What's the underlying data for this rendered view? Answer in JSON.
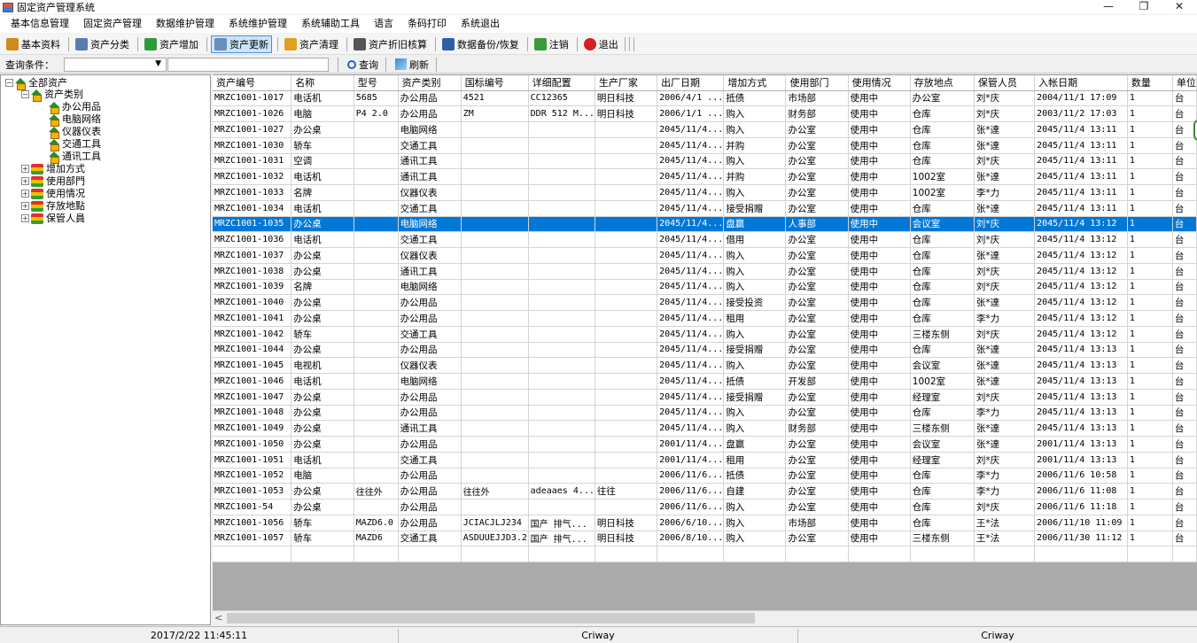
{
  "window": {
    "title": "固定资产管理系统",
    "controls": [
      "—",
      "❐",
      "✕"
    ]
  },
  "menu": [
    "基本信息管理",
    "固定资产管理",
    "数据维护管理",
    "系统维护管理",
    "系统辅助工具",
    "语言",
    "条码打印",
    "系统退出"
  ],
  "toolbar": [
    {
      "label": "基本资料",
      "icon": "basic-data-icon",
      "color": "#d08a1a",
      "active": false
    },
    {
      "label": "资产分类",
      "icon": "asset-category-icon",
      "color": "#5a7bb0",
      "active": false
    },
    {
      "label": "资产增加",
      "icon": "asset-add-icon",
      "color": "#2e9b3b",
      "active": false
    },
    {
      "label": "资产更新",
      "icon": "asset-update-icon",
      "color": "#6a8fb8",
      "active": true
    },
    {
      "label": "资产清理",
      "icon": "asset-clear-icon",
      "color": "#e0a020",
      "active": false
    },
    {
      "label": "资产折旧核算",
      "icon": "depreciation-icon",
      "color": "#555555",
      "active": false
    },
    {
      "label": "数据备份/恢复",
      "icon": "backup-icon",
      "color": "#2d5fa8",
      "active": false
    },
    {
      "label": "注销",
      "icon": "logout-icon",
      "color": "#3a9a3a",
      "active": false
    },
    {
      "label": "退出",
      "icon": "exit-icon",
      "color": "#d42020",
      "active": false
    }
  ],
  "query": {
    "label": "查询条件：",
    "select_value": "",
    "select_arrow": "▼",
    "input_value": "",
    "search_label": "查询",
    "refresh_label": "刷新"
  },
  "tree": {
    "root": "全部资产",
    "category": "资产类别",
    "categories": [
      "办公用品",
      "电脑网络",
      "仪器仪表",
      "交通工具",
      "通讯工具"
    ],
    "groups": [
      "增加方式",
      "使用部門",
      "使用情况",
      "存放地點",
      "保管人員"
    ]
  },
  "table": {
    "columns": [
      "资产编号",
      "名称",
      "型号",
      "资产类别",
      "国标编号",
      "详细配置",
      "生产厂家",
      "出厂日期",
      "增加方式",
      "使用部门",
      "使用情况",
      "存放地点",
      "保管人员",
      "入帐日期",
      "数量",
      "单位"
    ],
    "selected_index": 8,
    "rows": [
      [
        "MRZC1001-1017",
        "电话机",
        "5685",
        "办公用品",
        "4521",
        "CC12365",
        "明日科技",
        "2006/4/1 ...",
        "抵债",
        "市场部",
        "使用中",
        "办公室",
        "刘*庆",
        "2004/11/1 17:09",
        "1",
        "台"
      ],
      [
        "MRZC1001-1026",
        "电脑",
        "P4 2.0",
        "办公用品",
        "ZM",
        "DDR 512 M...",
        "明日科技",
        "2006/1/1 ...",
        "购入",
        "财务部",
        "使用中",
        "仓库",
        "刘*庆",
        "2003/11/2 17:03",
        "1",
        "台"
      ],
      [
        "MRZC1001-1027",
        "办公桌",
        "",
        "电脑网络",
        "",
        "",
        "",
        "2045/11/4...",
        "购入",
        "办公室",
        "使用中",
        "仓库",
        "张*達",
        "2045/11/4 13:11",
        "1",
        "台"
      ],
      [
        "MRZC1001-1030",
        "轿车",
        "",
        "交通工具",
        "",
        "",
        "",
        "2045/11/4...",
        "并购",
        "办公室",
        "使用中",
        "仓库",
        "张*達",
        "2045/11/4 13:11",
        "1",
        "台"
      ],
      [
        "MRZC1001-1031",
        "空调",
        "",
        "通讯工具",
        "",
        "",
        "",
        "2045/11/4...",
        "购入",
        "办公室",
        "使用中",
        "仓库",
        "刘*庆",
        "2045/11/4 13:11",
        "1",
        "台"
      ],
      [
        "MRZC1001-1032",
        "电话机",
        "",
        "通讯工具",
        "",
        "",
        "",
        "2045/11/4...",
        "并购",
        "办公室",
        "使用中",
        "1002室",
        "张*達",
        "2045/11/4 13:11",
        "1",
        "台"
      ],
      [
        "MRZC1001-1033",
        "名牌",
        "",
        "仪器仪表",
        "",
        "",
        "",
        "2045/11/4...",
        "购入",
        "办公室",
        "使用中",
        "1002室",
        "李*力",
        "2045/11/4 13:11",
        "1",
        "台"
      ],
      [
        "MRZC1001-1034",
        "电话机",
        "",
        "交通工具",
        "",
        "",
        "",
        "2045/11/4...",
        "接受捐赠",
        "办公室",
        "使用中",
        "仓库",
        "张*達",
        "2045/11/4 13:11",
        "1",
        "台"
      ],
      [
        "MRZC1001-1035",
        "办公桌",
        "",
        "电脑网络",
        "",
        "",
        "",
        "2045/11/4...",
        "盘赢",
        "人事部",
        "使用中",
        "会议室",
        "刘*庆",
        "2045/11/4 13:12",
        "1",
        "台"
      ],
      [
        "MRZC1001-1036",
        "电话机",
        "",
        "交通工具",
        "",
        "",
        "",
        "2045/11/4...",
        "借用",
        "办公室",
        "使用中",
        "仓库",
        "刘*庆",
        "2045/11/4 13:12",
        "1",
        "台"
      ],
      [
        "MRZC1001-1037",
        "办公桌",
        "",
        "仪器仪表",
        "",
        "",
        "",
        "2045/11/4...",
        "购入",
        "办公室",
        "使用中",
        "仓库",
        "张*達",
        "2045/11/4 13:12",
        "1",
        "台"
      ],
      [
        "MRZC1001-1038",
        "办公桌",
        "",
        "通讯工具",
        "",
        "",
        "",
        "2045/11/4...",
        "购入",
        "办公室",
        "使用中",
        "仓库",
        "刘*庆",
        "2045/11/4 13:12",
        "1",
        "台"
      ],
      [
        "MRZC1001-1039",
        "名牌",
        "",
        "电脑网络",
        "",
        "",
        "",
        "2045/11/4...",
        "购入",
        "办公室",
        "使用中",
        "仓库",
        "刘*庆",
        "2045/11/4 13:12",
        "1",
        "台"
      ],
      [
        "MRZC1001-1040",
        "办公桌",
        "",
        "办公用品",
        "",
        "",
        "",
        "2045/11/4...",
        "接受投资",
        "办公室",
        "使用中",
        "仓库",
        "张*達",
        "2045/11/4 13:12",
        "1",
        "台"
      ],
      [
        "MRZC1001-1041",
        "办公桌",
        "",
        "办公用品",
        "",
        "",
        "",
        "2045/11/4...",
        "租用",
        "办公室",
        "使用中",
        "仓库",
        "李*力",
        "2045/11/4 13:12",
        "1",
        "台"
      ],
      [
        "MRZC1001-1042",
        "轿车",
        "",
        "交通工具",
        "",
        "",
        "",
        "2045/11/4...",
        "购入",
        "办公室",
        "使用中",
        "三楼东侧",
        "刘*庆",
        "2045/11/4 13:12",
        "1",
        "台"
      ],
      [
        "MRZC1001-1044",
        "办公桌",
        "",
        "办公用品",
        "",
        "",
        "",
        "2045/11/4...",
        "接受捐赠",
        "办公室",
        "使用中",
        "仓库",
        "张*達",
        "2045/11/4 13:13",
        "1",
        "台"
      ],
      [
        "MRZC1001-1045",
        "电视机",
        "",
        "仪器仪表",
        "",
        "",
        "",
        "2045/11/4...",
        "购入",
        "办公室",
        "使用中",
        "会议室",
        "张*達",
        "2045/11/4 13:13",
        "1",
        "台"
      ],
      [
        "MRZC1001-1046",
        "电话机",
        "",
        "电脑网络",
        "",
        "",
        "",
        "2045/11/4...",
        "抵债",
        "开发部",
        "使用中",
        "1002室",
        "张*達",
        "2045/11/4 13:13",
        "1",
        "台"
      ],
      [
        "MRZC1001-1047",
        "办公桌",
        "",
        "办公用品",
        "",
        "",
        "",
        "2045/11/4...",
        "接受捐赠",
        "办公室",
        "使用中",
        "经理室",
        "刘*庆",
        "2045/11/4 13:13",
        "1",
        "台"
      ],
      [
        "MRZC1001-1048",
        "办公桌",
        "",
        "办公用品",
        "",
        "",
        "",
        "2045/11/4...",
        "购入",
        "办公室",
        "使用中",
        "仓库",
        "李*力",
        "2045/11/4 13:13",
        "1",
        "台"
      ],
      [
        "MRZC1001-1049",
        "办公桌",
        "",
        "通讯工具",
        "",
        "",
        "",
        "2045/11/4...",
        "购入",
        "财务部",
        "使用中",
        "三楼东侧",
        "张*達",
        "2045/11/4 13:13",
        "1",
        "台"
      ],
      [
        "MRZC1001-1050",
        "办公桌",
        "",
        "办公用品",
        "",
        "",
        "",
        "2001/11/4...",
        "盘赢",
        "办公室",
        "使用中",
        "会议室",
        "张*達",
        "2001/11/4 13:13",
        "1",
        "台"
      ],
      [
        "MRZC1001-1051",
        "电话机",
        "",
        "交通工具",
        "",
        "",
        "",
        "2001/11/4...",
        "租用",
        "办公室",
        "使用中",
        "经理室",
        "刘*庆",
        "2001/11/4 13:13",
        "1",
        "台"
      ],
      [
        "MRZC1001-1052",
        "电脑",
        "",
        "办公用品",
        "",
        "",
        "",
        "2006/11/6...",
        "抵债",
        "办公室",
        "使用中",
        "仓库",
        "李*力",
        "2006/11/6 10:58",
        "1",
        "台"
      ],
      [
        "MRZC1001-1053",
        "办公桌",
        "往往外",
        "办公用品",
        "往往外",
        "adeaaes 4...",
        "往往",
        "2006/11/6...",
        "自建",
        "办公室",
        "使用中",
        "仓库",
        "李*力",
        "2006/11/6 11:08",
        "1",
        "台"
      ],
      [
        "MRZC1001-54",
        "办公桌",
        "",
        "办公用品",
        "",
        "",
        "",
        "2006/11/6...",
        "购入",
        "办公室",
        "使用中",
        "仓库",
        "刘*庆",
        "2006/11/6 11:18",
        "1",
        "台"
      ],
      [
        "MRZC1001-1056",
        "轿车",
        "MAZD6.0",
        "办公用品",
        "JCIACJLJ234",
        "国产 排气...",
        "明日科技",
        "2006/6/10...",
        "购入",
        "市场部",
        "使用中",
        "仓库",
        "王*法",
        "2006/11/10 11:09",
        "1",
        "台"
      ],
      [
        "MRZC1001-1057",
        "轿车",
        "MAZD6",
        "交通工具",
        "ASDUUEJJD3.2",
        "国产 排气...",
        "明日科技",
        "2006/8/10...",
        "购入",
        "办公室",
        "使用中",
        "三楼东侧",
        "王*法",
        "2006/11/30 11:12",
        "1",
        "台"
      ]
    ]
  },
  "scrollbar": {
    "left_arrow": "<"
  },
  "status": {
    "datetime": "2017/2/22 11:45:11",
    "user": "Criway",
    "company": "Criway"
  }
}
